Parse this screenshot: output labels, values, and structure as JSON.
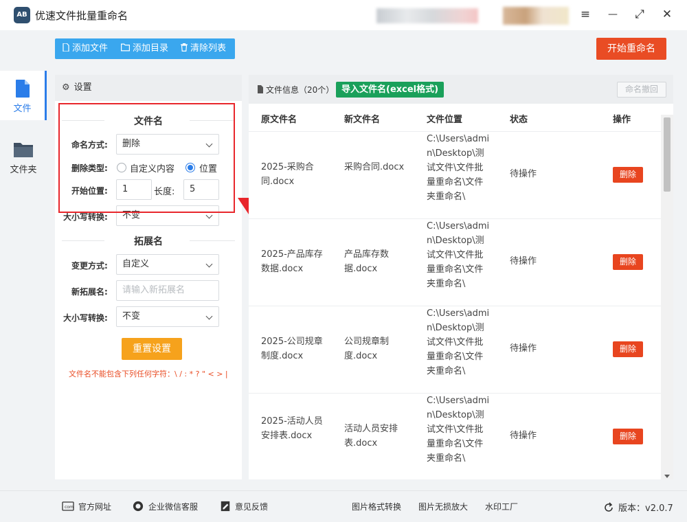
{
  "app": {
    "title": "优速文件批量重命名",
    "logo_text": "AB"
  },
  "window_controls": {
    "menu": "≡",
    "minimize": "—",
    "maximize": "⤢",
    "close": "✕"
  },
  "nav": {
    "items": [
      {
        "label": "文件",
        "icon": "file-icon",
        "active": true
      },
      {
        "label": "文件夹",
        "icon": "folder-icon",
        "active": false
      }
    ]
  },
  "toolbar": {
    "add_file": "添加文件",
    "add_dir": "添加目录",
    "clear_list": "清除列表",
    "start": "开始重命名"
  },
  "settings": {
    "header": "设置",
    "filename_section": "文件名",
    "naming_mode_label": "命名方式:",
    "naming_mode_value": "删除",
    "delete_type_label": "删除类型:",
    "delete_type_options": [
      "自定义内容",
      "位置"
    ],
    "delete_type_selected": "位置",
    "start_pos_label": "开始位置:",
    "start_pos_value": "1",
    "length_label": "长度:",
    "length_value": "5",
    "case_label": "大小写转换:",
    "case_value": "不变",
    "ext_section": "拓展名",
    "ext_mode_label": "变更方式:",
    "ext_mode_value": "自定义",
    "new_ext_label": "新拓展名:",
    "new_ext_placeholder": "请输入新拓展名",
    "ext_case_label": "大小写转换:",
    "ext_case_value": "不变",
    "reset": "重置设置",
    "warning": "文件名不能包含下列任何字符：\\ / : * ? \" < > |"
  },
  "files": {
    "header": "文件信息（20个）",
    "import_btn": "导入文件名(excel格式)",
    "undo_btn": "命名撤回",
    "columns": [
      "原文件名",
      "新文件名",
      "文件位置",
      "状态",
      "操作"
    ],
    "rows": [
      {
        "orig": "2025-采购合同.docx",
        "new": "采购合同.docx",
        "loc": "C:\\Users\\admin\\Desktop\\测试文件\\文件批量重命名\\文件夹重命名\\",
        "status": "待操作",
        "action": "删除"
      },
      {
        "orig": "2025-产品库存数据.docx",
        "new": "产品库存数据.docx",
        "loc": "C:\\Users\\admin\\Desktop\\测试文件\\文件批量重命名\\文件夹重命名\\",
        "status": "待操作",
        "action": "删除"
      },
      {
        "orig": "2025-公司规章制度.docx",
        "new": "公司规章制度.docx",
        "loc": "C:\\Users\\admin\\Desktop\\测试文件\\文件批量重命名\\文件夹重命名\\",
        "status": "待操作",
        "action": "删除"
      },
      {
        "orig": "2025-活动人员安排表.docx",
        "new": "活动人员安排表.docx",
        "loc": "C:\\Users\\admin\\Desktop\\测试文件\\文件批量重命名\\文件夹重命名\\",
        "status": "待操作",
        "action": "删除"
      }
    ]
  },
  "footer": {
    "website": "官方网址",
    "wechat": "企业微信客服",
    "feedback": "意见反馈",
    "img_convert": "图片格式转换",
    "img_enlarge": "图片无损放大",
    "watermark": "水印工厂",
    "version": "版本：v2.0.7"
  },
  "colors": {
    "accent": "#2b7de9",
    "toolbar": "#3aa7ee",
    "start": "#e94c24",
    "import": "#1aa05a",
    "reset": "#f6a21c",
    "annotation": "#e8262b"
  }
}
